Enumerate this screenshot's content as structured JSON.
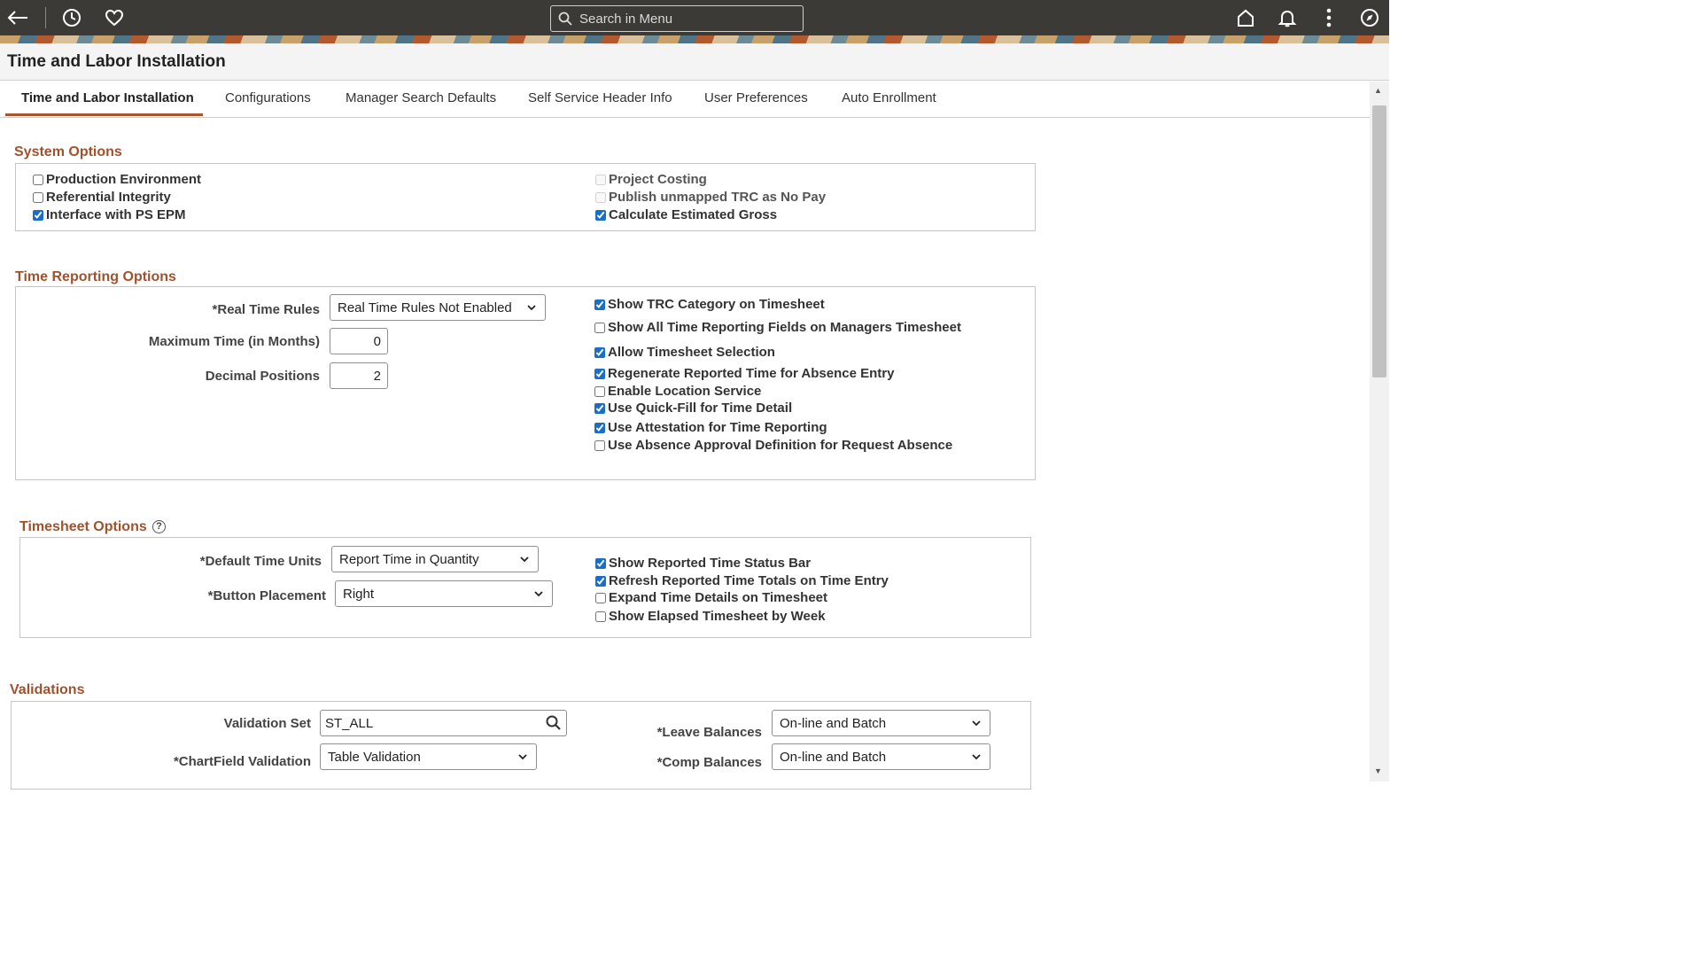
{
  "topbar": {
    "search_placeholder": "Search in Menu"
  },
  "page": {
    "title": "Time and Labor Installation"
  },
  "tabs": [
    {
      "label": "Time and Labor Installation",
      "active": true
    },
    {
      "label": "Configurations"
    },
    {
      "label": "Manager Search Defaults"
    },
    {
      "label": "Self Service Header Info"
    },
    {
      "label": "User Preferences"
    },
    {
      "label": "Auto Enrollment"
    }
  ],
  "system_options": {
    "title": "System Options",
    "left": [
      {
        "label": "Production Environment",
        "checked": false
      },
      {
        "label": "Referential Integrity",
        "checked": false
      },
      {
        "label": "Interface with PS EPM",
        "checked": true
      }
    ],
    "right": [
      {
        "label": "Project Costing",
        "checked": false,
        "disabled": true
      },
      {
        "label": "Publish unmapped TRC as No Pay",
        "checked": false,
        "disabled": true
      },
      {
        "label": "Calculate Estimated Gross",
        "checked": true
      }
    ]
  },
  "time_reporting": {
    "title": "Time Reporting Options",
    "real_time_rules_label": "*Real Time Rules",
    "real_time_rules_value": "Real Time Rules Not Enabled",
    "max_time_label": "Maximum Time (in Months)",
    "max_time_value": "0",
    "decimal_label": "Decimal Positions",
    "decimal_value": "2",
    "checkboxes": [
      {
        "label": "Show TRC Category on Timesheet",
        "checked": true
      },
      {
        "label": "Show All Time Reporting Fields on Managers Timesheet",
        "checked": false
      },
      {
        "label": "Allow Timesheet Selection",
        "checked": true
      },
      {
        "label": "Regenerate Reported Time for Absence Entry",
        "checked": true
      },
      {
        "label": "Enable Location Service",
        "checked": false
      },
      {
        "label": "Use Quick-Fill for Time Detail",
        "checked": true
      },
      {
        "label": "Use Attestation for Time Reporting",
        "checked": true
      },
      {
        "label": "Use Absence Approval Definition for Request Absence",
        "checked": false
      }
    ]
  },
  "timesheet_options": {
    "title": "Timesheet Options",
    "default_units_label": "*Default Time Units",
    "default_units_value": "Report Time in Quantity",
    "button_placement_label": "*Button Placement",
    "button_placement_value": "Right",
    "checkboxes": [
      {
        "label": "Show Reported Time Status Bar",
        "checked": true
      },
      {
        "label": "Refresh Reported Time Totals on Time Entry",
        "checked": true
      },
      {
        "label": "Expand Time Details on Timesheet",
        "checked": false
      },
      {
        "label": "Show Elapsed Timesheet by Week",
        "checked": false
      }
    ]
  },
  "validations": {
    "title": "Validations",
    "validation_set_label": "Validation Set",
    "validation_set_value": "ST_ALL",
    "chartfield_label": "*ChartField Validation",
    "chartfield_value": "Table Validation",
    "leave_label": "*Leave Balances",
    "leave_value": "On-line and Batch",
    "comp_label": "*Comp Balances",
    "comp_value": "On-line and Batch"
  },
  "colors": {
    "topbar": "#3b3a37",
    "section_title": "#a0522d",
    "tab_underline": "#a9552e",
    "checkbox_accent": "#1a6fc4"
  }
}
